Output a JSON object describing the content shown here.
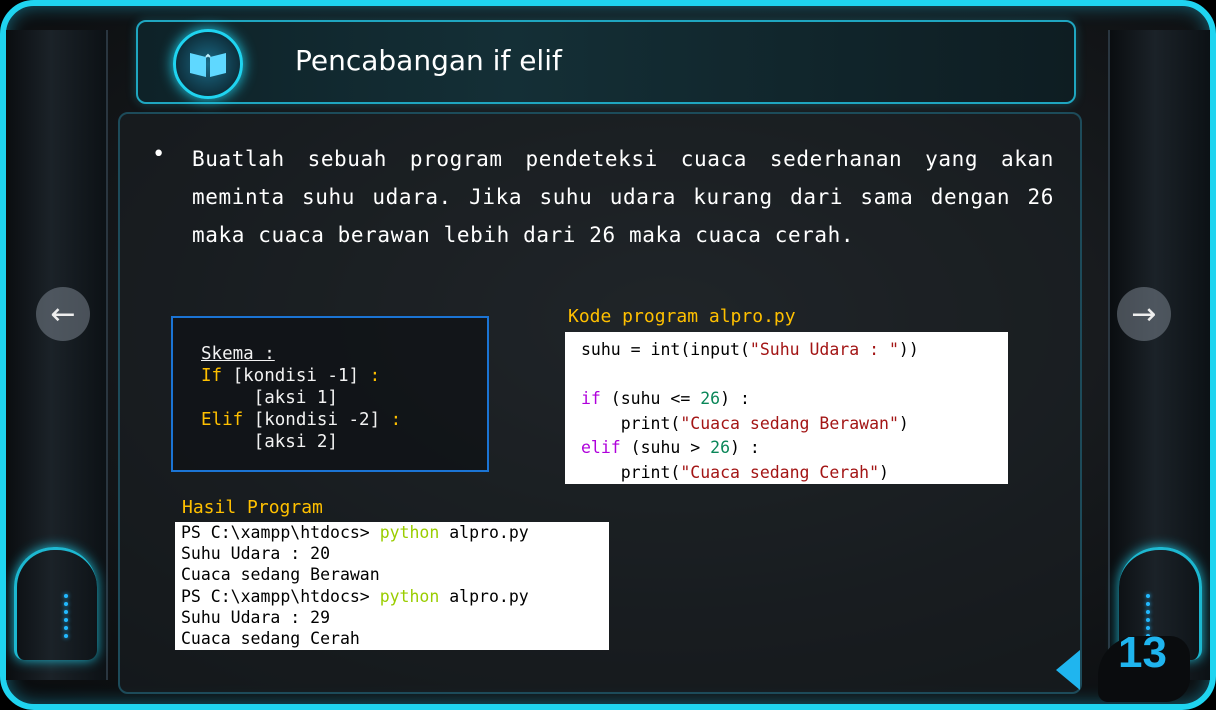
{
  "slide": {
    "title": "Pencabangan if elif",
    "page_number": "13"
  },
  "navigation": {
    "prev_symbol": "←",
    "next_symbol": "→"
  },
  "body": {
    "bullet": "•",
    "text": "Buatlah sebuah program pendeteksi cuaca sederhanan yang akan meminta suhu udara. Jika suhu udara kurang dari sama dengan 26 maka cuaca berawan lebih dari 26 maka cuaca cerah."
  },
  "schema": {
    "title": "Skema :",
    "line1_kw": "If",
    "line1_rest": " [kondisi -1] ",
    "line1_colon": ":",
    "line2": "     [aksi 1]",
    "line3_kw": "Elif",
    "line3_rest": " [kondisi -2] ",
    "line3_colon": ":",
    "line4": "     [aksi 2]"
  },
  "code": {
    "label": "Kode program alpro.py",
    "l1_a": "suhu = int(input(",
    "l1_str": "\"Suhu Udara : \"",
    "l1_b": "))",
    "l3_kw": "if",
    "l3_a": " (suhu <= ",
    "l3_num": "26",
    "l3_b": ") :",
    "l4_a": "    print(",
    "l4_str": "\"Cuaca sedang Berawan\"",
    "l4_b": ")",
    "l5_kw": "elif",
    "l5_a": " (suhu > ",
    "l5_num": "26",
    "l5_b": ") :",
    "l6_a": "    print(",
    "l6_str": "\"Cuaca sedang Cerah\"",
    "l6_b": ")"
  },
  "result": {
    "label": "Hasil Program",
    "prompt1": "PS C:\\xampp\\htdocs> ",
    "cmd1": "python",
    "arg1": " alpro.py",
    "out1": "Suhu Udara : 20",
    "out2": "Cuaca sedang Berawan",
    "prompt2": "PS C:\\xampp\\htdocs> ",
    "cmd2": "python",
    "arg2": " alpro.py",
    "out3": "Suhu Udara : 29",
    "out4": "Cuaca sedang Cerah"
  },
  "colors": {
    "accent": "#1fd4f0",
    "keyword_yellow": "#ffc000",
    "python_cmd": "#9acd00"
  }
}
